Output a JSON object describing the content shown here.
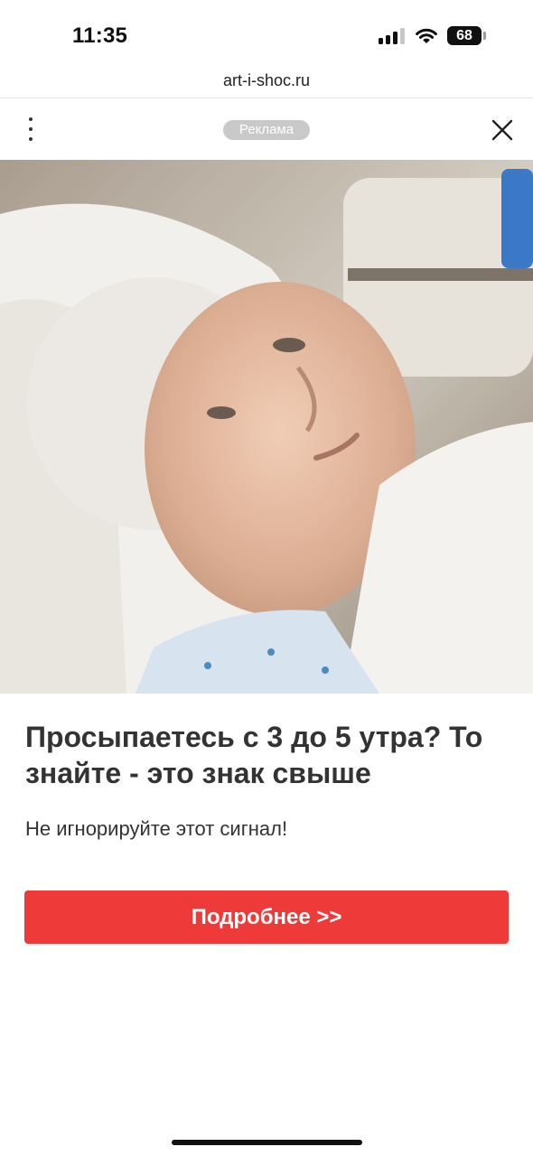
{
  "status_bar": {
    "time": "11:35",
    "battery": "68",
    "signal_bars_active": 3,
    "signal_bars_total": 4
  },
  "browser": {
    "url": "art-i-shoc.ru"
  },
  "ad": {
    "badge": "Реклама",
    "headline": "Просыпаетесь с 3 до 5 утра? То знайте - это знак свыше",
    "subtext": "Не игнорируйте этот сигнал!",
    "cta_label": "Подробнее >>",
    "cta_color": "#ef3a3a"
  },
  "icons": {
    "menu": "more-vertical-icon",
    "close": "close-icon",
    "wifi": "wifi-icon",
    "signal": "cellular-signal-icon",
    "battery": "battery-icon"
  }
}
